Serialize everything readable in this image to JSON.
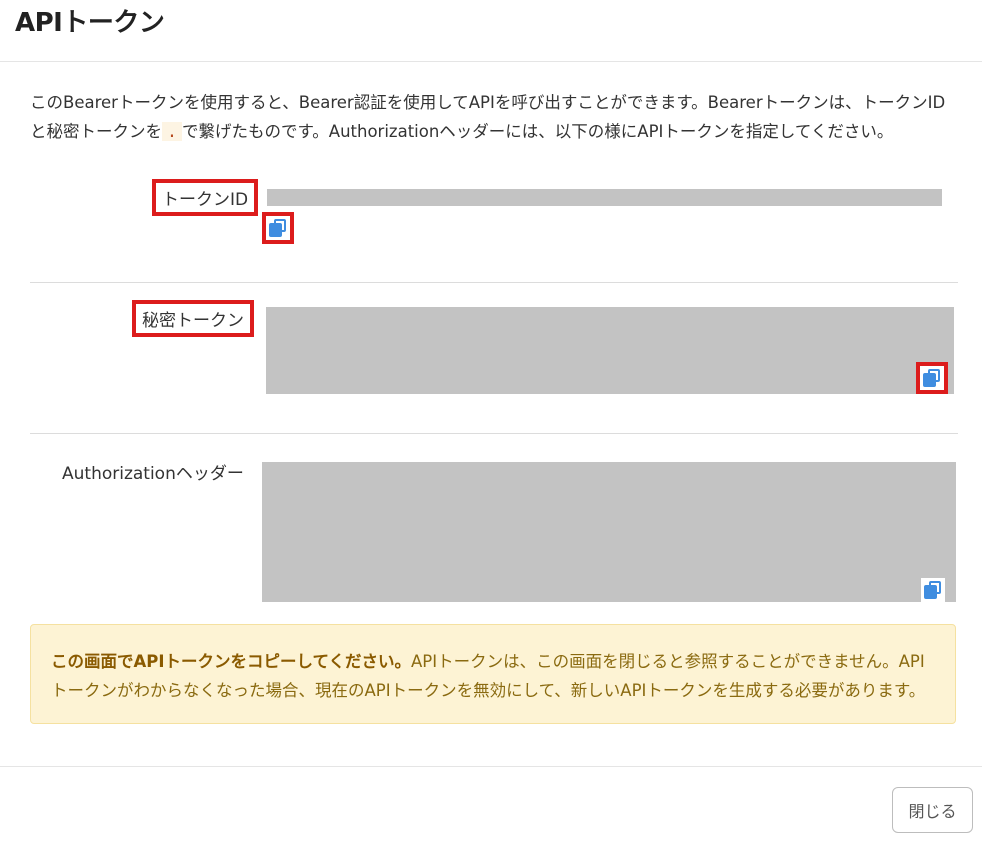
{
  "modal": {
    "title": "APIトークン"
  },
  "description": {
    "part1": "このBearerトークンを使用すると、Bearer認証を使用してAPIを呼び出すことができます。Bearerトークンは、トークンIDと秘密トークンを",
    "separator": ".",
    "part2": "で繋げたものです。Authorizationヘッダーには、以下の様にAPIトークンを指定してください。"
  },
  "fields": {
    "token_id_label": "トークンID",
    "secret_token_label": "秘密トークン",
    "authorization_header_label": "Authorizationヘッダー"
  },
  "alert": {
    "bold": "この画面でAPIトークンをコピーしてください。",
    "text": "APIトークンは、この画面を閉じると参照することができません。APIトークンがわからなくなった場合、現在のAPIトークンを無効にして、新しいAPIトークンを生成する必要があります。"
  },
  "footer": {
    "close_label": "閉じる"
  },
  "colors": {
    "highlight": "#dc1c1c",
    "copy_icon": "#3f8de0",
    "redacted": "#c3c3c3",
    "alert_bg": "#fdf3d4"
  },
  "icons": {
    "copy": "copy-icon"
  }
}
